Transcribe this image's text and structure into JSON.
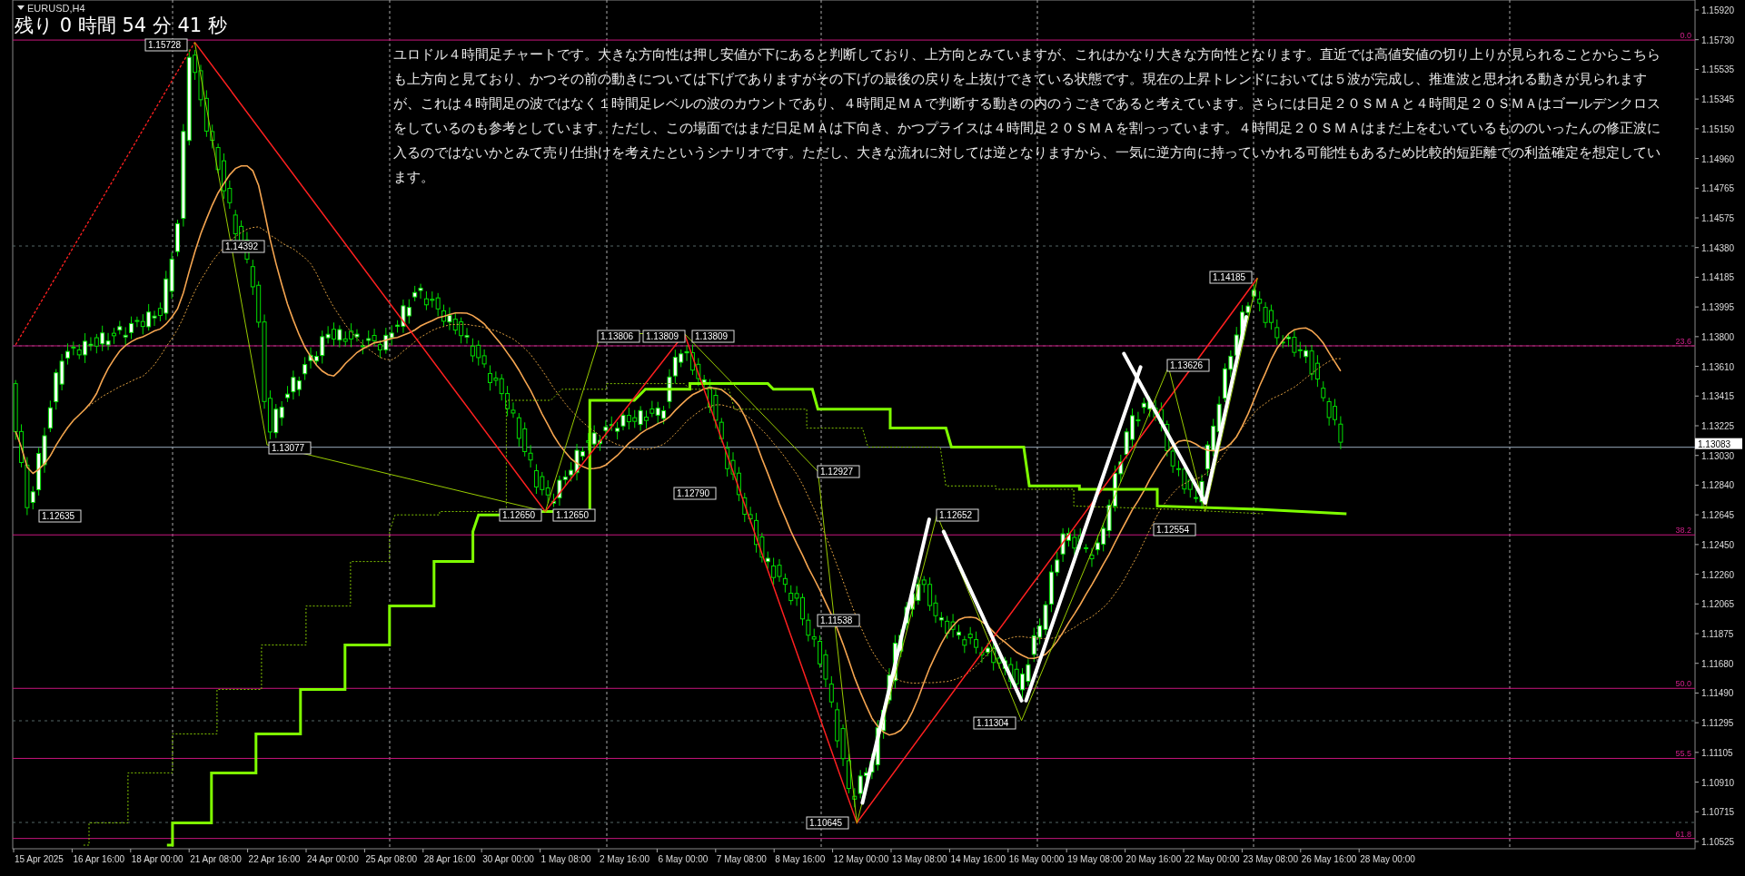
{
  "chart": {
    "symbol": "EURUSD,H4",
    "countdown": "残り 0 時間 54 分 41 秒",
    "commentary": "ユロドル４時間足チャートです。大きな方向性は押し安値が下にあると判断しており、上方向とみていますが、これはかなり大きな方向性となります。直近では高値安値の切り上りが見られることからこちらも上方向と見ており、かつその前の動きについては下げでありますがその下げの最後の戻りを上抜けできている状態です。現在の上昇トレンドにおいては５波が完成し、推進波と思われる動きが見られますが、これは４時間足の波ではなく１時間足レベルの波のカウントであり、４時間足ＭＡで判断する動きの内のうごきであると考えています。さらには日足２０ＳＭＡと４時間足２０ＳＭＡはゴールデンクロスをしているのも参考としています。ただし、この場面ではまだ日足ＭＡは下向き、かつプライスは４時間足２０ＳＭＡを割っっています。４時間足２０ＳＭＡはまだ上をむいているもののいったんの修正波に入るのではないかとみて売り仕掛けを考えたというシナリオです。ただし、大きな流れに対しては逆となりますから、一気に逆方向に持っていかれる可能性もあるため比較的短距離での利益確定を想定しています。",
    "price_axis": [
      "1.15920",
      "1.15730",
      "1.15535",
      "1.15345",
      "1.15150",
      "1.14960",
      "1.14765",
      "1.14575",
      "1.14380",
      "1.14185",
      "1.13995",
      "1.13800",
      "1.13610",
      "1.13415",
      "1.13225",
      "1.13030",
      "1.12840",
      "1.12645",
      "1.12450",
      "1.12260",
      "1.12065",
      "1.11875",
      "1.11680",
      "1.11490",
      "1.11295",
      "1.11105",
      "1.10910",
      "1.10715",
      "1.10525"
    ],
    "current_price": "1.13083",
    "time_axis": [
      "15 Apr 2025",
      "16 Apr 16:00",
      "18 Apr 00:00",
      "21 Apr 08:00",
      "22 Apr 16:00",
      "24 Apr 00:00",
      "25 Apr 08:00",
      "28 Apr 16:00",
      "30 Apr 00:00",
      "1 May 08:00",
      "2 May 16:00",
      "6 May 00:00",
      "7 May 08:00",
      "8 May 16:00",
      "12 May 00:00",
      "13 May 08:00",
      "14 May 16:00",
      "16 May 00:00",
      "19 May 08:00",
      "20 May 16:00",
      "22 May 00:00",
      "23 May 08:00",
      "26 May 16:00",
      "28 May 00:00"
    ],
    "swing_labels": [
      "1.15728",
      "1.14392",
      "1.13077",
      "1.12635",
      "1.12650",
      "1.12650",
      "1.13806",
      "1.13809",
      "1.13809",
      "1.12790",
      "1.12927",
      "1.11538",
      "1.12652",
      "1.10645",
      "1.11304",
      "1.13626",
      "1.12554",
      "1.14185"
    ],
    "fib_levels": [
      "0.0",
      "23.6",
      "38.2",
      "50.0",
      "55.5",
      "61.8"
    ]
  }
}
